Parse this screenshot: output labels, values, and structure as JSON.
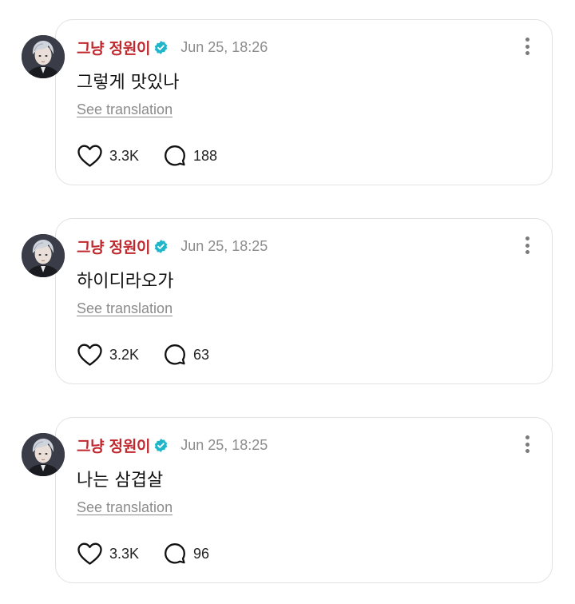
{
  "posts": [
    {
      "author": "그냥 정원이",
      "timestamp": "Jun 25, 18:26",
      "text": "그렇게 맛있나",
      "translate_label": "See translation",
      "likes": "3.3K",
      "replies": "188"
    },
    {
      "author": "그냥 정원이",
      "timestamp": "Jun 25, 18:25",
      "text": "하이디라오가",
      "translate_label": "See translation",
      "likes": "3.2K",
      "replies": "63"
    },
    {
      "author": "그냥 정원이",
      "timestamp": "Jun 25, 18:25",
      "text": "나는 삼겹살",
      "translate_label": "See translation",
      "likes": "3.3K",
      "replies": "96"
    }
  ],
  "icons": {
    "verified": "verified-badge-icon",
    "like": "heart-icon",
    "reply": "speech-bubble-icon",
    "more": "more-vertical-icon"
  },
  "colors": {
    "author": "#c0282e",
    "verified": "#1fb6c9",
    "muted": "#8c8c8c",
    "card_border": "#e2e2e2"
  }
}
